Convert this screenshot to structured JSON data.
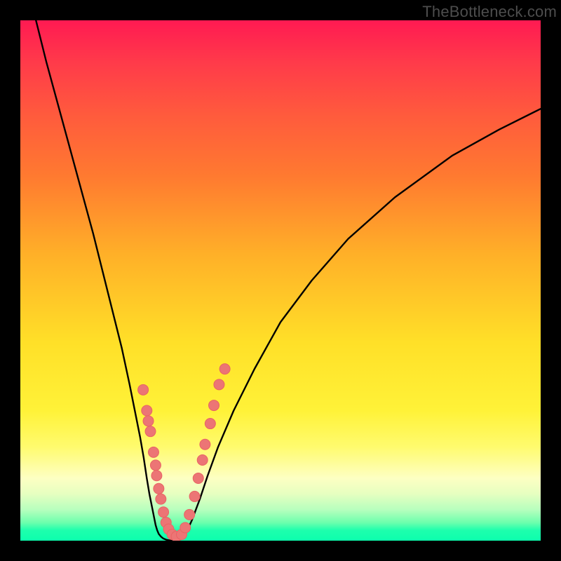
{
  "watermark": {
    "text": "TheBottleneck.com"
  },
  "chart_data": {
    "type": "line",
    "title": "",
    "xlabel": "",
    "ylabel": "",
    "xlim": [
      0,
      100
    ],
    "ylim": [
      0,
      100
    ],
    "grid": false,
    "legend": false,
    "series": [
      {
        "name": "curve1",
        "x": [
          3,
          5,
          8,
          11,
          14,
          16,
          18,
          19.5,
          21,
          22,
          23,
          23.7,
          24.3,
          24.8,
          25.3,
          25.7,
          26,
          26.3,
          26.6,
          27,
          27.5,
          28,
          28.5,
          29,
          29.5
        ],
        "y": [
          100,
          92,
          81,
          70,
          59,
          51,
          43,
          37,
          30,
          25,
          20,
          16,
          12,
          9,
          6.5,
          4.5,
          3,
          2,
          1.3,
          0.8,
          0.4,
          0.2,
          0.1,
          0.05,
          0
        ]
      },
      {
        "name": "curve2",
        "x": [
          29.5,
          30,
          30.5,
          31,
          31.5,
          32,
          33,
          34.5,
          36,
          38,
          41,
          45,
          50,
          56,
          63,
          72,
          83,
          92,
          100
        ],
        "y": [
          0,
          0.05,
          0.15,
          0.4,
          0.9,
          1.8,
          4,
          8,
          12.5,
          18,
          25,
          33,
          42,
          50,
          58,
          66,
          74,
          79,
          83
        ]
      }
    ],
    "dot_scatter": [
      {
        "x": 23.6,
        "y": 29
      },
      {
        "x": 24.3,
        "y": 25
      },
      {
        "x": 24.6,
        "y": 23
      },
      {
        "x": 25.0,
        "y": 21
      },
      {
        "x": 25.6,
        "y": 17
      },
      {
        "x": 26.0,
        "y": 14.5
      },
      {
        "x": 26.2,
        "y": 12.5
      },
      {
        "x": 26.6,
        "y": 10
      },
      {
        "x": 27.0,
        "y": 8
      },
      {
        "x": 27.5,
        "y": 5.5
      },
      {
        "x": 28.0,
        "y": 3.5
      },
      {
        "x": 28.5,
        "y": 2.2
      },
      {
        "x": 29.2,
        "y": 1.2
      },
      {
        "x": 30.0,
        "y": 0.8
      },
      {
        "x": 31.0,
        "y": 1.2
      },
      {
        "x": 31.7,
        "y": 2.5
      },
      {
        "x": 32.5,
        "y": 5.0
      },
      {
        "x": 33.5,
        "y": 8.5
      },
      {
        "x": 34.2,
        "y": 12
      },
      {
        "x": 35.0,
        "y": 15.5
      },
      {
        "x": 35.5,
        "y": 18.5
      },
      {
        "x": 36.5,
        "y": 22.5
      },
      {
        "x": 37.2,
        "y": 26
      },
      {
        "x": 38.2,
        "y": 30
      },
      {
        "x": 39.3,
        "y": 33
      }
    ],
    "colors": {
      "curve_stroke": "#000000",
      "dot_fill": "#ec7575",
      "dot_stroke": "#e86464"
    }
  }
}
